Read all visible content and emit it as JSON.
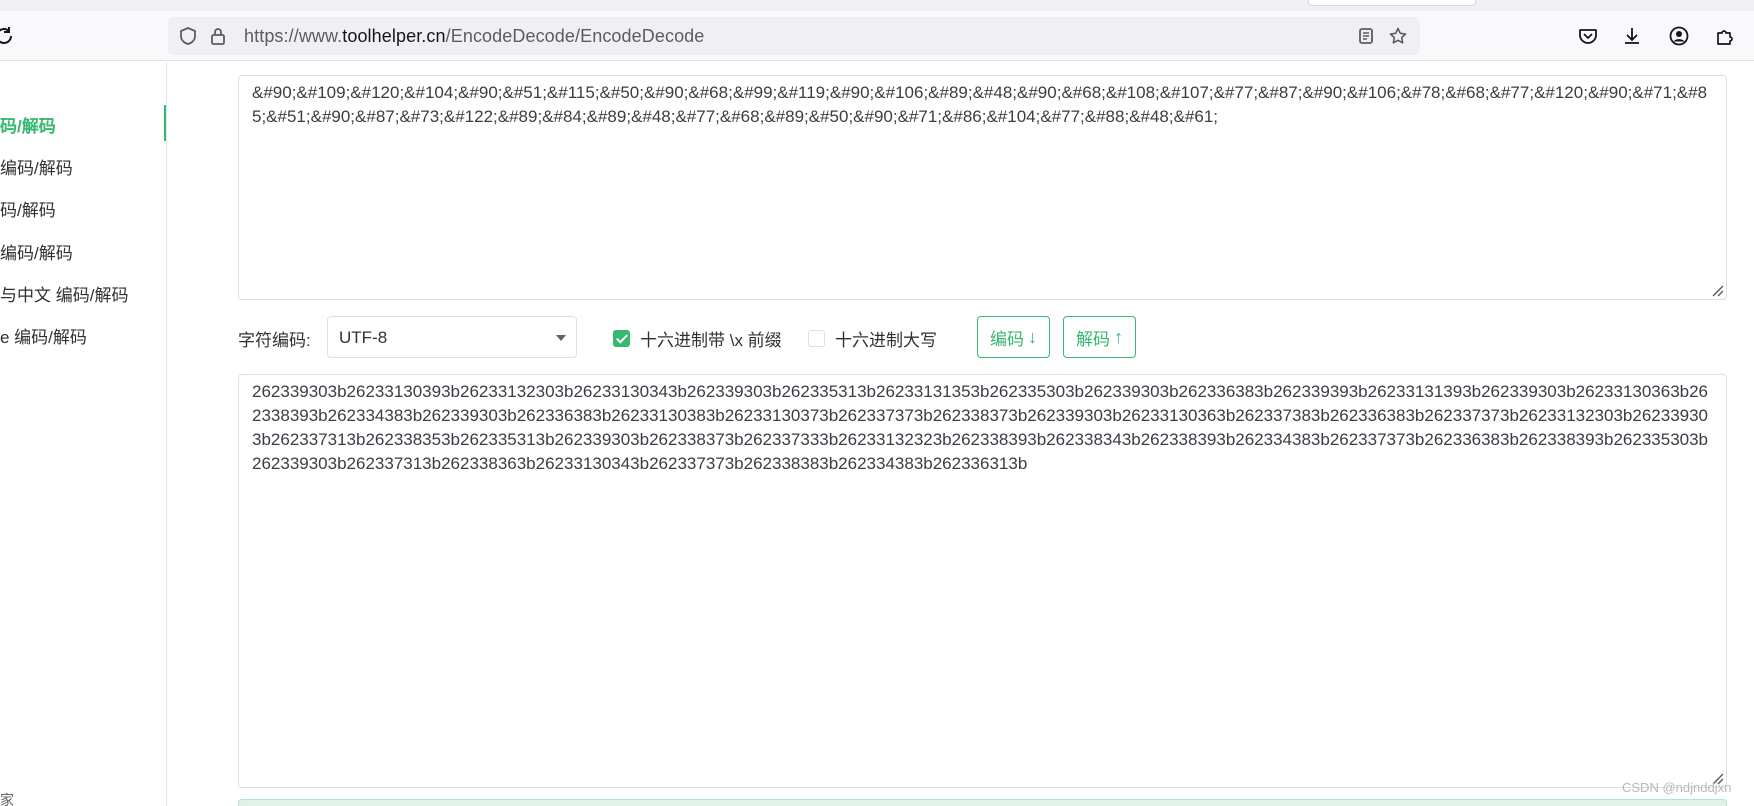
{
  "browser": {
    "url_prefix": "https://www.",
    "url_host": "toolhelper.cn",
    "url_path": "/EncodeDecode/EncodeDecode"
  },
  "sidebar": {
    "items": [
      {
        "label": "码/解码",
        "active": true
      },
      {
        "label": "  编码/解码",
        "active": false
      },
      {
        "label": "码/解码",
        "active": false
      },
      {
        "label": "编码/解码",
        "active": false
      },
      {
        "label": "与中文  编码/解码",
        "active": false
      },
      {
        "label": "e  编码/解码",
        "active": false
      }
    ],
    "bottom_glyph": "家"
  },
  "input": {
    "value": "&#90;&#109;&#120;&#104;&#90;&#51;&#115;&#50;&#90;&#68;&#99;&#119;&#90;&#106;&#89;&#48;&#90;&#68;&#108;&#107;&#77;&#87;&#90;&#106;&#78;&#68;&#77;&#120;&#90;&#71;&#85;&#51;&#90;&#87;&#73;&#122;&#89;&#84;&#89;&#48;&#77;&#68;&#89;&#50;&#90;&#71;&#86;&#104;&#77;&#88;&#48;&#61;"
  },
  "controls": {
    "charset_label": "字符编码:",
    "charset_value": "UTF-8",
    "hex_prefix_label": "十六进制带 \\x 前缀",
    "hex_prefix_checked": true,
    "hex_upper_label": "十六进制大写",
    "hex_upper_checked": false,
    "encode_label": "编码",
    "encode_arrow": "↓",
    "decode_label": "解码",
    "decode_arrow": "↑"
  },
  "output": {
    "value": "262339303b26233130393b26233132303b26233130343b262339303b262335313b26233131353b262335303b262339303b262336383b262339393b26233131393b262339303b26233130363b262338393b262334383b262339303b262336383b26233130383b26233130373b262337373b262338373b262339303b26233130363b262337383b262336383b262337373b26233132303b262339303b262337313b262338353b262335313b262339303b262338373b262337333b26233132323b262338393b262338343b262338393b262334383b262337373b262336383b262338393b262335303b262339303b262337313b262338363b26233130343b262337373b262338383b262334383b262336313b"
  },
  "watermark": "CSDN @ndjnddjxn",
  "colors": {
    "accent": "#35b86f",
    "border": "#dcdfe6"
  }
}
